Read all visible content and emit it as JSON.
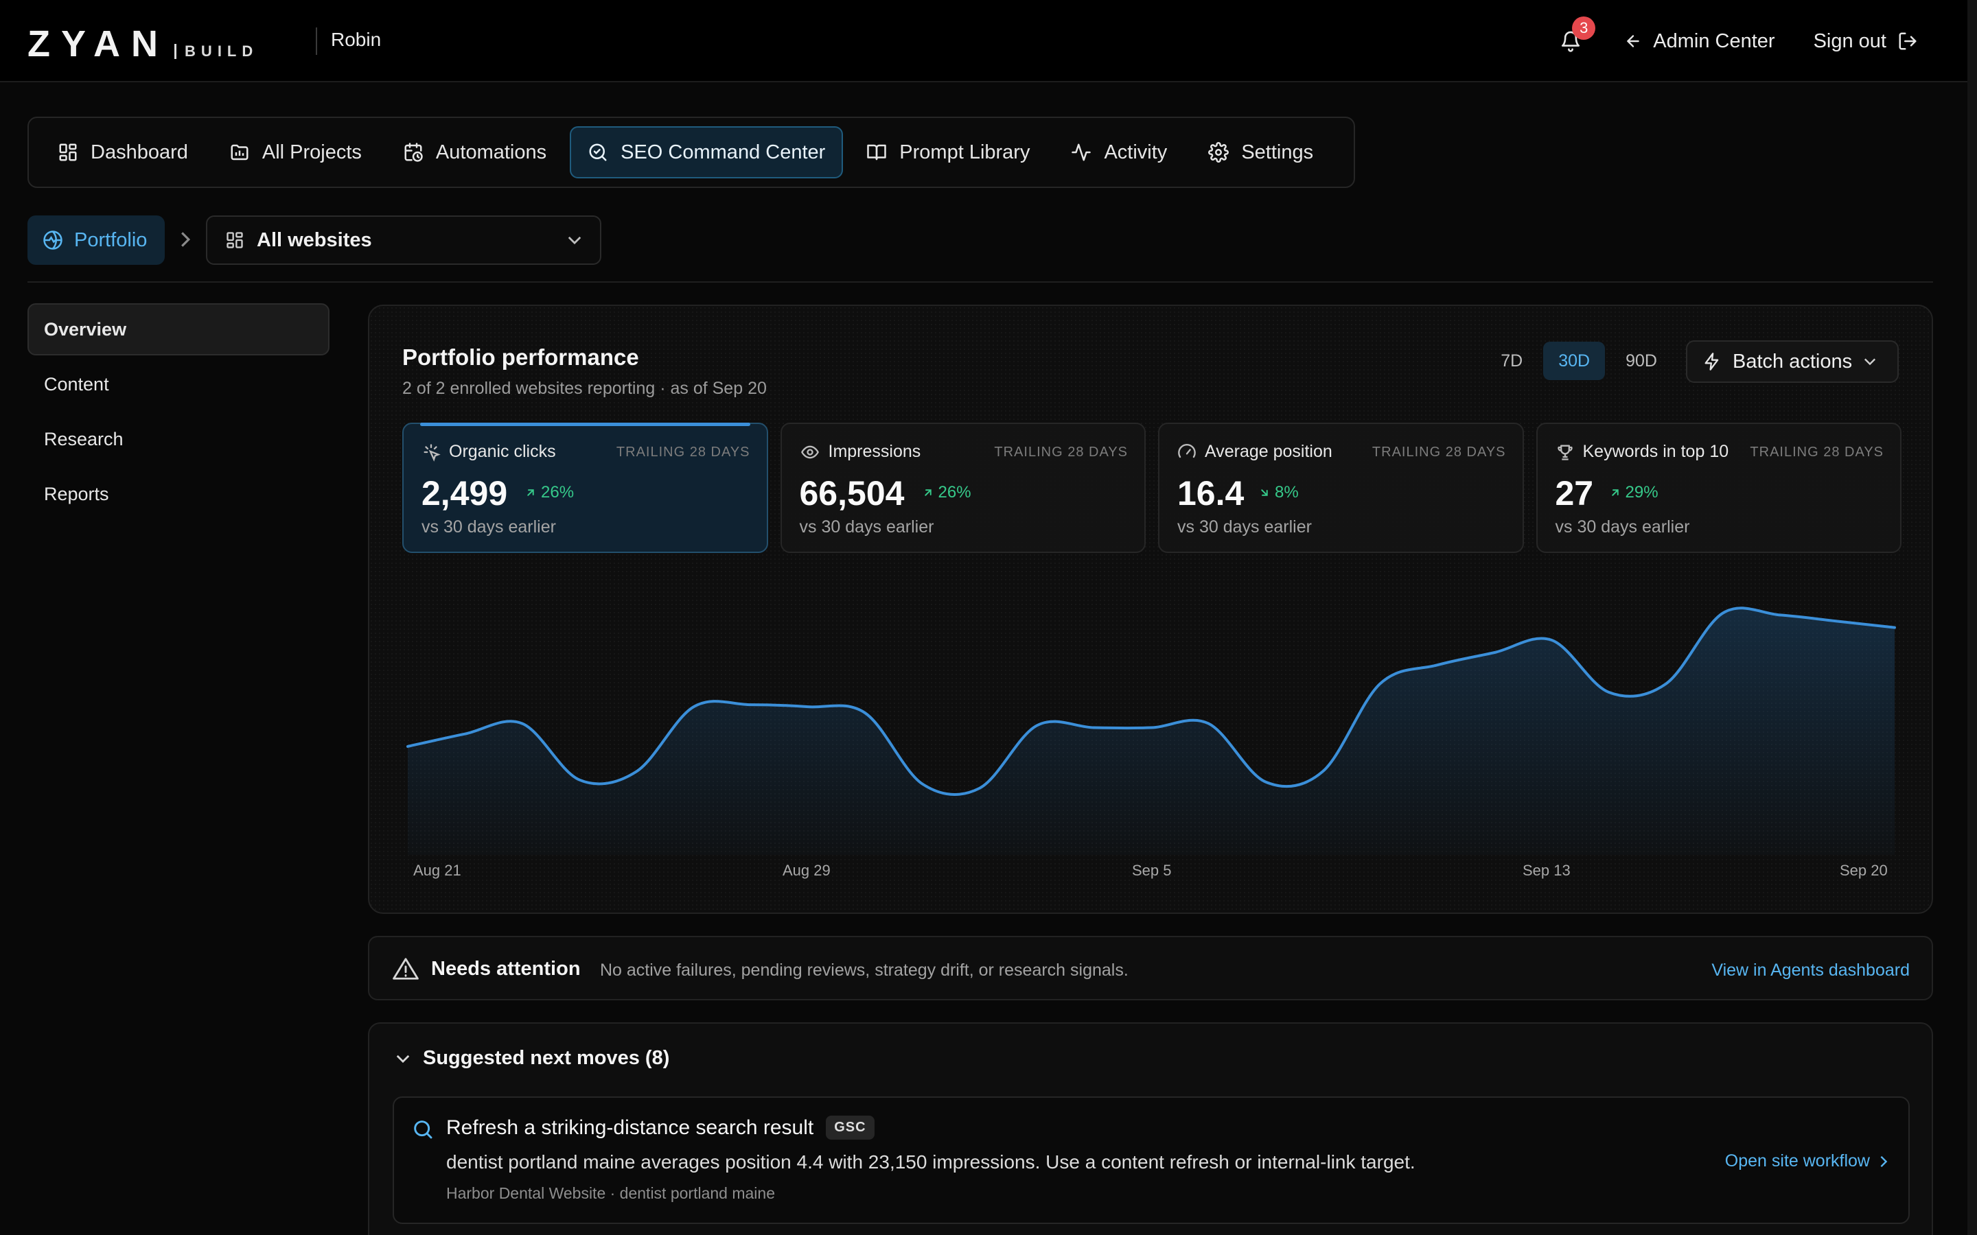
{
  "brand": {
    "logo_main": "ZYAN",
    "logo_sub": "BUILD",
    "workspace": "Robin"
  },
  "header": {
    "notification_count": "3",
    "admin_label": "Admin Center",
    "signout_label": "Sign out"
  },
  "nav": {
    "items": [
      {
        "label": "Dashboard",
        "icon": "dashboard-icon"
      },
      {
        "label": "All Projects",
        "icon": "projects-icon"
      },
      {
        "label": "Automations",
        "icon": "calendar-clock-icon"
      },
      {
        "label": "SEO Command Center",
        "icon": "search-icon",
        "active": true
      },
      {
        "label": "Prompt Library",
        "icon": "book-icon"
      },
      {
        "label": "Activity",
        "icon": "activity-icon"
      },
      {
        "label": "Settings",
        "icon": "gear-icon"
      }
    ]
  },
  "breadcrumb": {
    "portfolio_label": "Portfolio",
    "site_selector": "All websites"
  },
  "sidebar": {
    "items": [
      "Overview",
      "Content",
      "Research",
      "Reports"
    ],
    "active": "Overview"
  },
  "performance": {
    "title": "Portfolio performance",
    "subtitle": "2 of 2 enrolled websites reporting · as of Sep 20",
    "ranges": [
      "7D",
      "30D",
      "90D"
    ],
    "active_range": "30D",
    "batch_label": "Batch actions",
    "kpis": [
      {
        "label": "Organic clicks",
        "trailing": "TRAILING 28 DAYS",
        "value": "2,499",
        "delta": "26%",
        "direction": "up",
        "foot": "vs 30 days earlier",
        "icon": "sparkle-icon"
      },
      {
        "label": "Impressions",
        "trailing": "TRAILING 28 DAYS",
        "value": "66,504",
        "delta": "26%",
        "direction": "up",
        "foot": "vs 30 days earlier",
        "icon": "eye-icon"
      },
      {
        "label": "Average position",
        "trailing": "TRAILING 28 DAYS",
        "value": "16.4",
        "delta": "8%",
        "direction": "down",
        "foot": "vs 30 days earlier",
        "icon": "gauge-icon"
      },
      {
        "label": "Keywords in top 10",
        "trailing": "TRAILING 28 DAYS",
        "value": "27",
        "delta": "29%",
        "direction": "up",
        "foot": "vs 30 days earlier",
        "icon": "trophy-icon"
      }
    ]
  },
  "chart_data": {
    "type": "area",
    "title": "",
    "xlabel": "",
    "ylabel": "",
    "x_ticks": [
      "Aug 21",
      "Aug 29",
      "Sep 5",
      "Sep 13",
      "Sep 20"
    ],
    "series": [
      {
        "values": [
          52,
          58,
          63,
          36,
          40,
          71,
          72,
          71,
          68,
          34,
          32,
          62,
          61,
          61,
          63,
          35,
          40,
          82,
          91,
          97,
          103,
          78,
          82,
          116,
          115,
          112,
          109
        ],
        "color": "#3b8fd9"
      }
    ],
    "ylim": [
      0,
      125
    ],
    "grid": false
  },
  "attention": {
    "title": "Needs attention",
    "text": "No active failures, pending reviews, strategy drift, or research signals.",
    "link": "View in Agents dashboard"
  },
  "suggestions": {
    "header": "Suggested next moves (8)",
    "items": [
      {
        "title": "Refresh a striking-distance search result",
        "badge": "GSC",
        "description": "dentist portland maine averages position 4.4 with 23,150 impressions. Use a content refresh or internal-link target.",
        "meta": "Harbor Dental Website · dentist portland maine",
        "link": "Open site workflow"
      }
    ]
  },
  "colors": {
    "accent": "#58b6f2",
    "positive": "#36c98a",
    "badge": "#e5484d",
    "line": "#3b8fd9"
  }
}
